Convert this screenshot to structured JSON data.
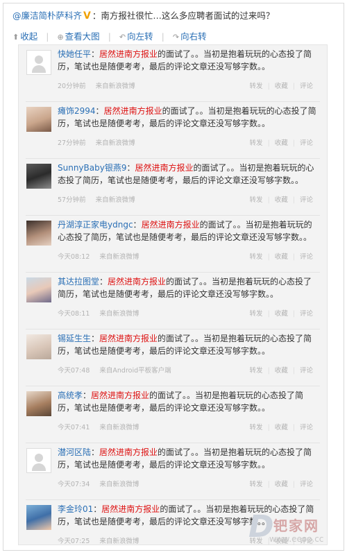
{
  "post": {
    "author": "@廉洁简朴萨科齐",
    "verified_badge": "V",
    "text": "：南方报社很忙…这么多应聘者面试的过来吗？"
  },
  "toolbar": {
    "collapse": "收起",
    "view_large": "查看大图",
    "rotate_left": "向左转",
    "rotate_right": "向右转"
  },
  "actions": {
    "repost": "转发",
    "favorite": "收藏",
    "comment": "评论",
    "separator": "|"
  },
  "comments": [
    {
      "name": "快她任平",
      "pre": "：",
      "hl": "居然进南方报业",
      "post": "的面试了。。当初是抱着玩玩的心态投了简历，笔试也是随便考考，最后的评论文章还没写够字数。。",
      "time": "20分钟前",
      "source": "来自新浪微博"
    },
    {
      "name": "瘫饰2994",
      "pre": "：",
      "hl": "居然进南方报业",
      "post": "的面试了。。当初是抱着玩玩的心态投了简历，笔试也是随便考考，最后的评论文章还没写够字数。。",
      "time": "27分钟前",
      "source": "来自新浪微博"
    },
    {
      "name": "SunnyBaby银燕9",
      "pre": "：",
      "hl": "居然进南方报业",
      "post": "的面试了。。当初是抱着玩玩的心态投了简历，笔试也是随便考考，最后的评论文章还没写够字数。。",
      "time": "57分钟前",
      "source": "来自新浪微博"
    },
    {
      "name": "丹湖淳正家电ydngc",
      "pre": "：",
      "hl": "居然进南方报业",
      "post": "的面试了。。当初是抱着玩玩的心态投了简历，笔试也是随便考考，最后的评论文章还没写够字数。。",
      "time": "今天08:12",
      "source": "来自新浪微博"
    },
    {
      "name": "其达拉图堂",
      "pre": "：",
      "hl": "居然进南方报业",
      "post": "的面试了。。当初是抱着玩玩的心态投了简历，笔试也是随便考考，最后的评论文章还没写够字数。。",
      "time": "今天08:11",
      "source": "来自新浪微博"
    },
    {
      "name": "锡延生生",
      "pre": "：",
      "hl": "居然进南方报业",
      "post": "的面试了。。当初是抱着玩玩的心态投了简历，笔试也是随便考考，最后的评论文章还没写够字数。。",
      "time": "今天07:48",
      "source": "来自Android平板客户端"
    },
    {
      "name": "高统孝",
      "pre": "：",
      "hl": "居然进南方报业",
      "post": "的面试了。。当初是抱着玩玩的心态投了简历，笔试也是随便考考，最后的评论文章还没写够字数。。",
      "time": "今天07:41",
      "source": "来自新浪微博"
    },
    {
      "name": "潜河区陆",
      "pre": "：",
      "hl": "居然进南方报业",
      "post": "的面试了。。当初是抱着玩玩的心态投了简历，笔试也是随便考考，最后的评论文章还没写够字数。。",
      "time": "今天07:34",
      "source": "来自新浪微博"
    },
    {
      "name": "李金玲01",
      "pre": "：",
      "hl": "居然进南方报业",
      "post": "的面试了。。当初是抱着玩玩的心态投了简历，笔试也是随便考考，最后的评论文章还没写够字数。。",
      "time": "今天07:25",
      "source": "来自新浪微博"
    }
  ],
  "watermark": {
    "site": "钯家网",
    "url": "www.eeoo.cc"
  },
  "colors": {
    "link": "#2a6fb5",
    "highlight": "#dd1111",
    "meta": "#b3b3b3",
    "panel_bg": "#f3f3f3"
  }
}
